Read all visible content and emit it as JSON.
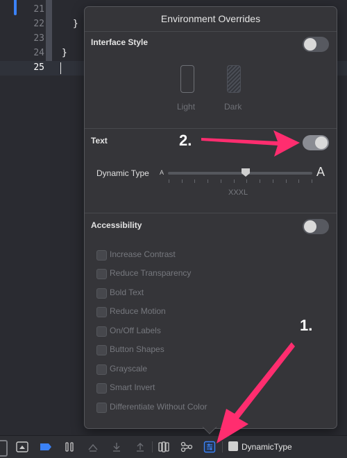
{
  "editor": {
    "lines": [
      {
        "num": "21",
        "code": ""
      },
      {
        "num": "22",
        "code": "}"
      },
      {
        "num": "23",
        "code": ""
      },
      {
        "num": "24",
        "code": "}"
      },
      {
        "num": "25",
        "code": ""
      }
    ],
    "current_line": "25"
  },
  "popover": {
    "title": "Environment Overrides",
    "interface_style": {
      "title": "Interface Style",
      "enabled": false,
      "options": [
        {
          "label": "Light"
        },
        {
          "label": "Dark"
        }
      ]
    },
    "text": {
      "title": "Text",
      "enabled": true,
      "dynamic_type_label": "Dynamic Type",
      "small_a": "A",
      "large_a": "A",
      "selected_size": "XXXL"
    },
    "accessibility": {
      "title": "Accessibility",
      "enabled": false,
      "options": [
        {
          "label": "Increase Contrast",
          "checked": false
        },
        {
          "label": "Reduce Transparency",
          "checked": false
        },
        {
          "label": "Bold Text",
          "checked": false
        },
        {
          "label": "Reduce Motion",
          "checked": false
        },
        {
          "label": "On/Off Labels",
          "checked": false
        },
        {
          "label": "Button Shapes",
          "checked": false
        },
        {
          "label": "Grayscale",
          "checked": false
        },
        {
          "label": "Smart Invert",
          "checked": false
        },
        {
          "label": "Differentiate Without Color",
          "checked": false
        }
      ]
    }
  },
  "toolbar": {
    "scheme_label": "DynamicType",
    "icons": [
      "console-toggle-icon",
      "breakpoint-icon",
      "pause-icon",
      "step-over-icon",
      "step-into-icon",
      "step-out-icon",
      "view-hierarchy-icon",
      "memory-graph-icon",
      "environment-overrides-icon",
      "scheme-icon"
    ]
  },
  "annotations": {
    "step1": "1.",
    "step2": "2."
  },
  "colors": {
    "accent": "#3b82f6",
    "annotation_arrow": "#ff2d6f",
    "popover_bg": "#353539",
    "editor_bg": "#292a30"
  }
}
